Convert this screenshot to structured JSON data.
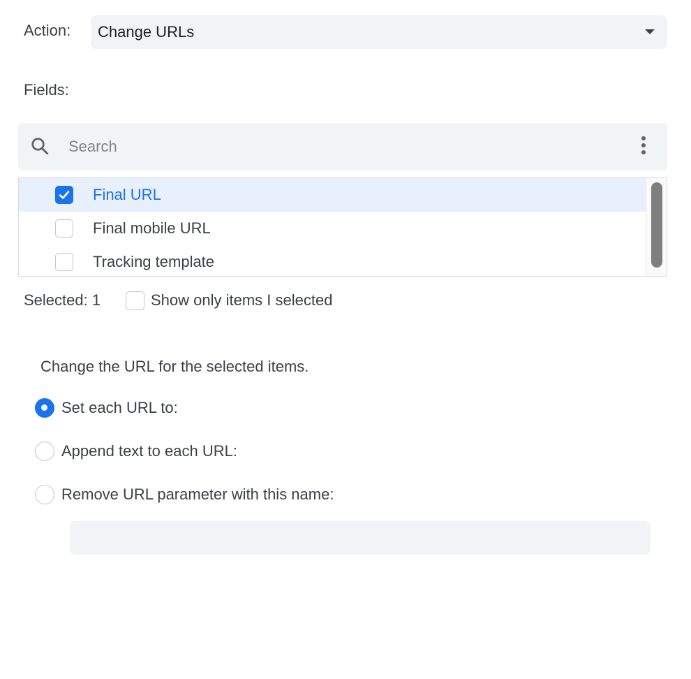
{
  "action": {
    "label": "Action:",
    "selected_value": "Change URLs"
  },
  "fields": {
    "label": "Fields:",
    "search": {
      "placeholder": "Search",
      "value": ""
    },
    "items": [
      {
        "label": "Final URL",
        "checked": true
      },
      {
        "label": "Final mobile URL",
        "checked": false
      },
      {
        "label": "Tracking template",
        "checked": false
      }
    ],
    "selected_count_text": "Selected: 1",
    "show_only_selected": {
      "label": "Show only items I selected",
      "checked": false
    }
  },
  "url_change": {
    "description": "Change the URL for the selected items.",
    "options": [
      {
        "label": "Set each URL to:",
        "checked": true
      },
      {
        "label": "Append text to each URL:",
        "checked": false
      },
      {
        "label": "Remove URL parameter with this name:",
        "checked": false
      }
    ],
    "input_value": ""
  },
  "colors": {
    "accent": "#1a73e8",
    "selected_row_bg": "#e8f0fe",
    "field_bg": "#f1f3f4",
    "text": "#3c4043"
  },
  "icons": {
    "search": "search-icon",
    "more": "more-vert-icon",
    "dropdown": "caret-down-icon",
    "check": "check-icon"
  }
}
